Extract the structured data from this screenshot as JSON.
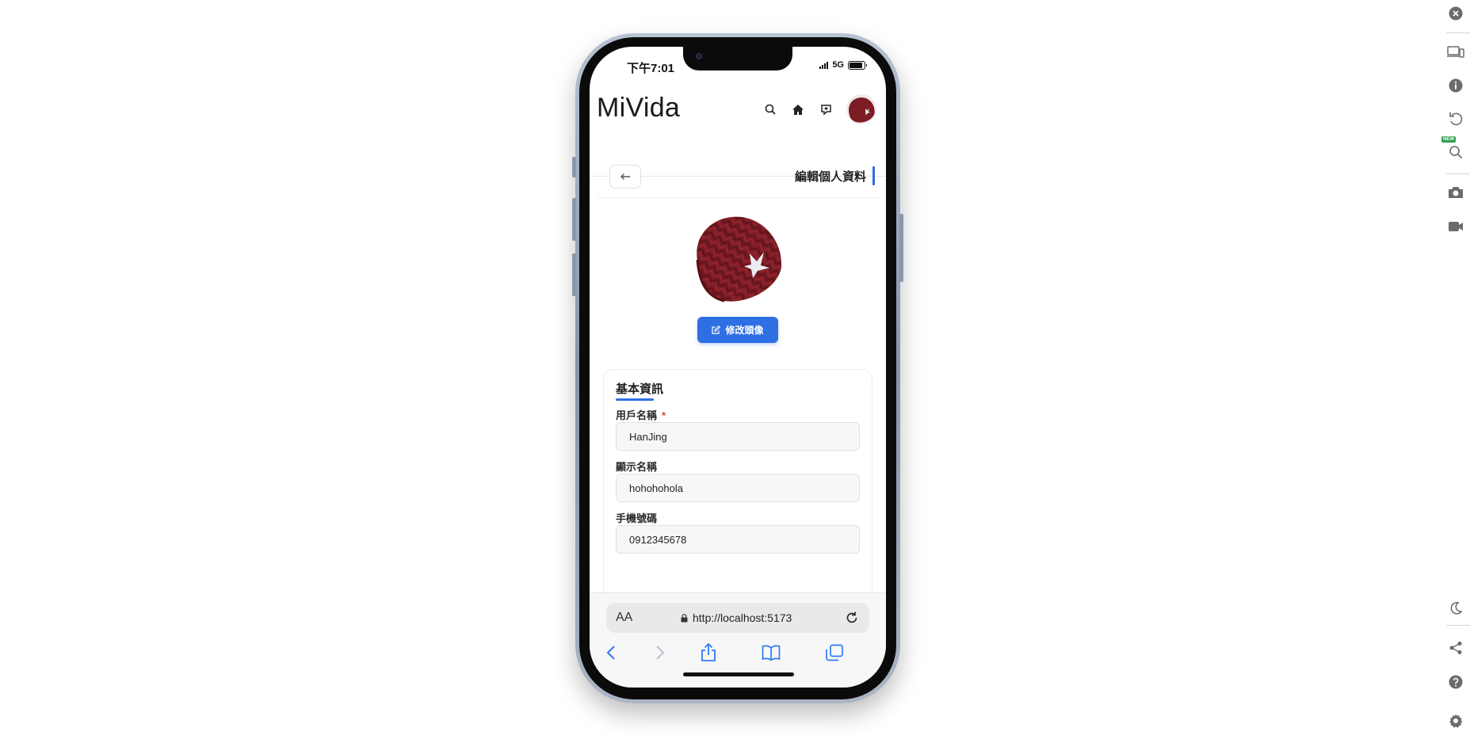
{
  "status_bar": {
    "time": "下午7:01",
    "network": "5G",
    "battery_level": 0.9
  },
  "app": {
    "brand": "MiVida"
  },
  "header_icons": [
    "search-icon",
    "home-icon",
    "add-post-icon",
    "user-avatar"
  ],
  "page": {
    "title": "編輯個人資料",
    "change_avatar_label": "修改頭像"
  },
  "form": {
    "section_title": "基本資訊",
    "required_mark": "*",
    "fields": [
      {
        "label": "用戶名稱",
        "value": "HanJing",
        "required": true
      },
      {
        "label": "顯示名稱",
        "value": "hohohohola",
        "required": false
      },
      {
        "label": "手機號碼",
        "value": "0912345678",
        "required": false
      }
    ]
  },
  "browser": {
    "aa_label": "AA",
    "url": "http://localhost:5173"
  },
  "colors": {
    "accent": "#2f6fe4",
    "required": "#e23d3d",
    "beanie": "#7c1c24",
    "ios_blue": "#2f7cf6"
  },
  "rail_icons": [
    "close-icon",
    "devices-icon",
    "info-icon",
    "rotate-icon",
    "zoom-icon",
    "camera-icon",
    "video-icon",
    "moon-icon",
    "share-icon",
    "help-icon",
    "settings-icon"
  ],
  "rail_badge": "NEW"
}
